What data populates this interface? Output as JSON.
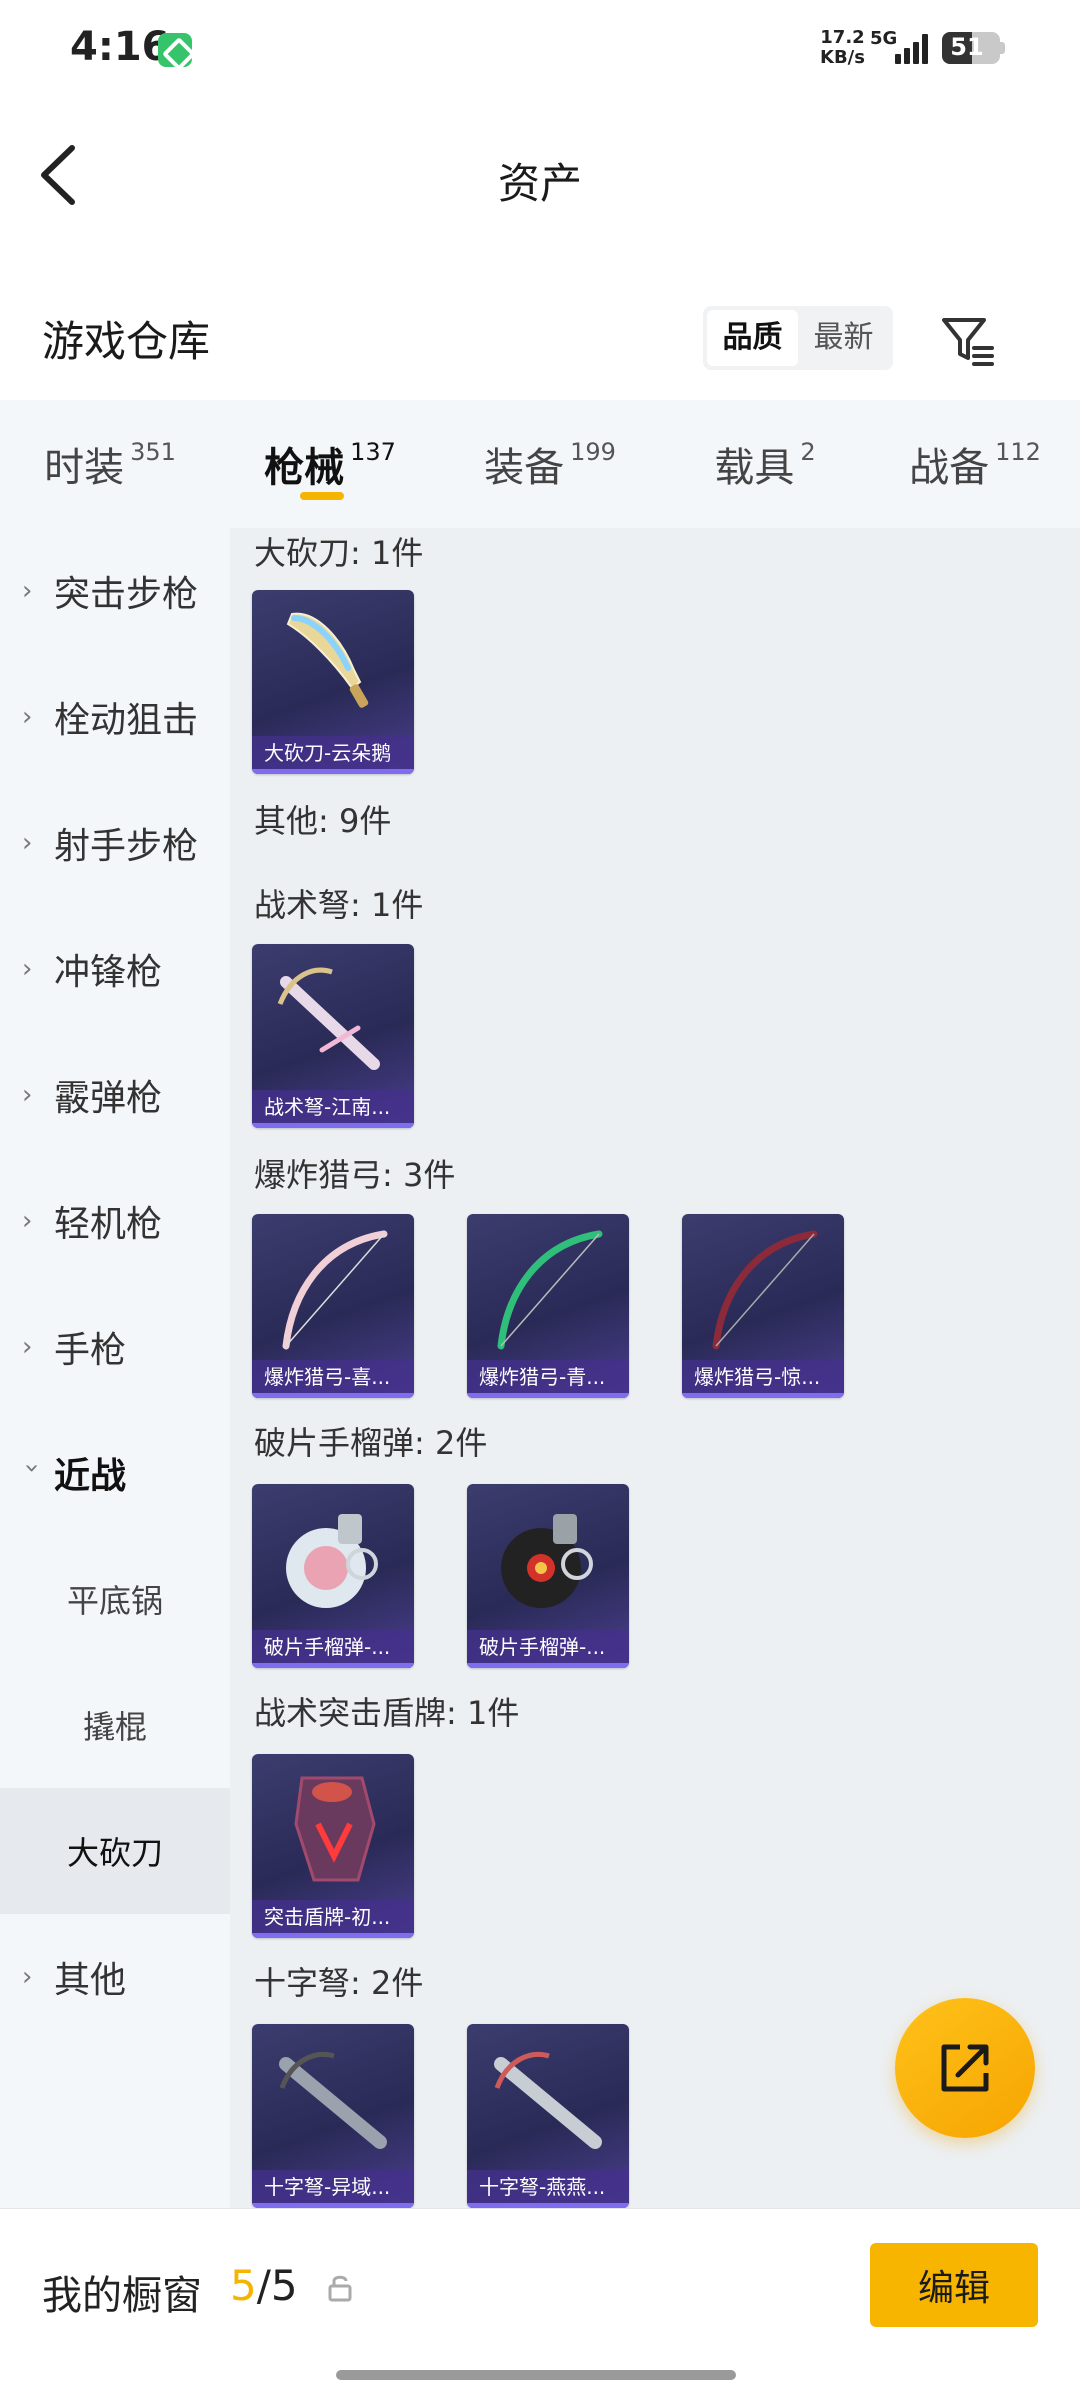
{
  "status_bar": {
    "time": "4:16",
    "speed_value": "17.2",
    "speed_unit": "KB/s",
    "network": "5G",
    "battery": "51",
    "battery_level": 0.51
  },
  "header": {
    "back_icon": "back-arrow-icon",
    "title": "资产"
  },
  "warehouse": {
    "title": "游戏仓库",
    "sort_options": [
      "品质",
      "最新"
    ],
    "sort_selected": "品质",
    "filter_icon": "filter-icon"
  },
  "tabs": [
    {
      "label": "时装",
      "count": "351"
    },
    {
      "label": "枪械",
      "count": "137",
      "active": true
    },
    {
      "label": "装备",
      "count": "199"
    },
    {
      "label": "载具",
      "count": "2"
    },
    {
      "label": "战备",
      "count": "112"
    }
  ],
  "sidebar": {
    "items": [
      {
        "label": "突击步枪",
        "type": "category"
      },
      {
        "label": "栓动狙击",
        "type": "category"
      },
      {
        "label": "射手步枪",
        "type": "category"
      },
      {
        "label": "冲锋枪",
        "type": "category"
      },
      {
        "label": "霰弹枪",
        "type": "category"
      },
      {
        "label": "轻机枪",
        "type": "category"
      },
      {
        "label": "手枪",
        "type": "category"
      },
      {
        "label": "近战",
        "type": "expanded"
      },
      {
        "label": "平底锅",
        "type": "sub"
      },
      {
        "label": "撬棍",
        "type": "sub"
      },
      {
        "label": "大砍刀",
        "type": "sub",
        "selected": true
      },
      {
        "label": "其他",
        "type": "category"
      }
    ]
  },
  "groups": [
    {
      "title": "大砍刀: 1件",
      "items": [
        {
          "name": "大砍刀-云朵鹅",
          "icon": "machete-icon"
        }
      ]
    },
    {
      "title": "其他: 9件",
      "items": []
    },
    {
      "title": "战术弩: 1件",
      "items": [
        {
          "name": "战术弩-江南...",
          "icon": "crossbow-icon"
        }
      ]
    },
    {
      "title": "爆炸猎弓: 3件",
      "items": [
        {
          "name": "爆炸猎弓-喜...",
          "icon": "bow-icon"
        },
        {
          "name": "爆炸猎弓-青...",
          "icon": "bow-icon"
        },
        {
          "name": "爆炸猎弓-惊...",
          "icon": "bow-icon"
        }
      ]
    },
    {
      "title": "破片手榴弹: 2件",
      "items": [
        {
          "name": "破片手榴弹-...",
          "icon": "grenade-icon"
        },
        {
          "name": "破片手榴弹-...",
          "icon": "grenade-icon"
        }
      ]
    },
    {
      "title": "战术突击盾牌: 1件",
      "items": [
        {
          "name": "突击盾牌-初...",
          "icon": "shield-icon"
        }
      ]
    },
    {
      "title": "十字弩: 2件",
      "items": [
        {
          "name": "十字弩-异域...",
          "icon": "crossbow-icon"
        },
        {
          "name": "十字弩-燕燕...",
          "icon": "crossbow-icon"
        }
      ]
    }
  ],
  "fab": {
    "icon": "share-external-icon"
  },
  "showcase": {
    "label": "我的橱窗",
    "current": "5",
    "separator": "/",
    "total": "5",
    "lock_icon": "lock-icon",
    "edit_label": "编辑"
  },
  "colors": {
    "accent": "#f5b400",
    "card_bg": "#2f2f5e",
    "caption_bar": "#7f6df0",
    "sidebar_bg": "#f4f7fa",
    "content_bg": "#ecf0f3"
  }
}
